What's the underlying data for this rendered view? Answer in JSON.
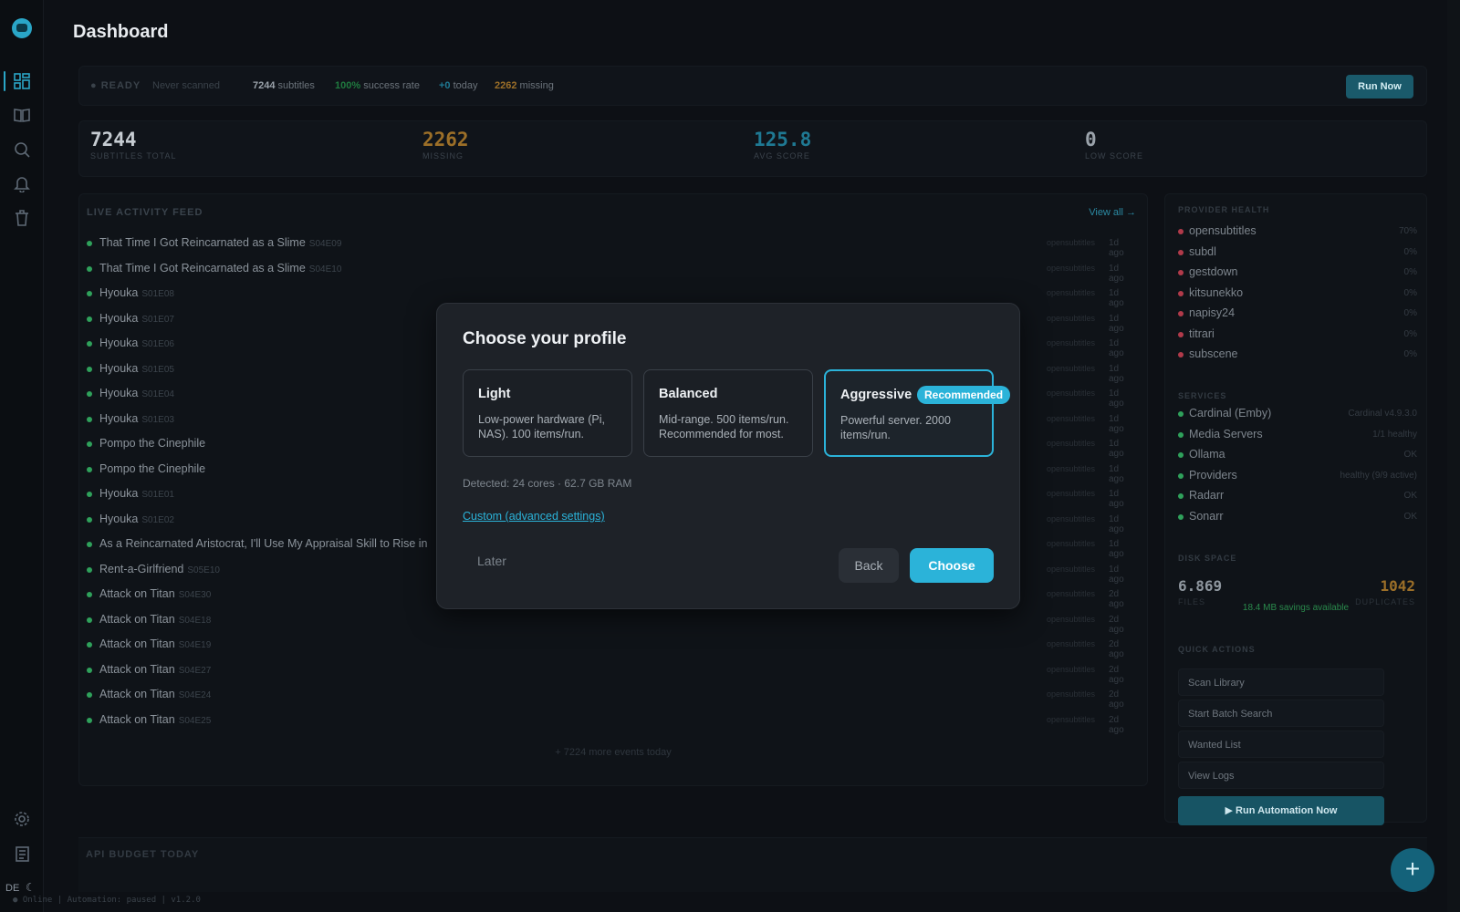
{
  "sidebar": {
    "logo_icon": "subtitle-bubble-icon",
    "nav_icons": [
      "dashboard-icon",
      "library-icon",
      "search-icon",
      "bell-icon",
      "trash-icon"
    ],
    "bottom_icons": [
      "gear-icon",
      "logs-icon"
    ],
    "lang": "DE",
    "theme_icon": "moon-icon"
  },
  "header": {
    "title": "Dashboard"
  },
  "status_bar": {
    "state": "READY",
    "scan_text": "Never scanned",
    "subtitles_count": "7244",
    "subtitles_label": "subtitles",
    "success_rate": "100%",
    "success_label": "success rate",
    "today_count": "+0",
    "today_label": "today",
    "missing_count": "2262",
    "missing_label": "missing",
    "run_now": "Run Now"
  },
  "stats": [
    {
      "value": "7244",
      "label": "SUBTITLES TOTAL",
      "color": "#c6ccd2"
    },
    {
      "value": "2262",
      "label": "MISSING",
      "color": "#9c6f28"
    },
    {
      "value": "125.8",
      "label": "AVG SCORE",
      "color": "#1f7993"
    },
    {
      "value": "0",
      "label": "LOW SCORE",
      "color": "#9aa2aa"
    }
  ],
  "feed": {
    "title": "LIVE ACTIVITY FEED",
    "view_all": "View all →",
    "rows": [
      {
        "title": "That Time I Got Reincarnated as a Slime",
        "ep": "S04E09",
        "provider": "opensubtitles",
        "time": "1d ago"
      },
      {
        "title": "That Time I Got Reincarnated as a Slime",
        "ep": "S04E10",
        "provider": "opensubtitles",
        "time": "1d ago"
      },
      {
        "title": "Hyouka",
        "ep": "S01E08",
        "provider": "opensubtitles",
        "time": "1d ago"
      },
      {
        "title": "Hyouka",
        "ep": "S01E07",
        "provider": "opensubtitles",
        "time": "1d ago"
      },
      {
        "title": "Hyouka",
        "ep": "S01E06",
        "provider": "opensubtitles",
        "time": "1d ago"
      },
      {
        "title": "Hyouka",
        "ep": "S01E05",
        "provider": "opensubtitles",
        "time": "1d ago"
      },
      {
        "title": "Hyouka",
        "ep": "S01E04",
        "provider": "opensubtitles",
        "time": "1d ago"
      },
      {
        "title": "Hyouka",
        "ep": "S01E03",
        "provider": "opensubtitles",
        "time": "1d ago"
      },
      {
        "title": "Pompo the Cinephile",
        "ep": "",
        "provider": "opensubtitles",
        "time": "1d ago"
      },
      {
        "title": "Pompo the Cinephile",
        "ep": "",
        "provider": "opensubtitles",
        "time": "1d ago"
      },
      {
        "title": "Hyouka",
        "ep": "S01E01",
        "provider": "opensubtitles",
        "time": "1d ago"
      },
      {
        "title": "Hyouka",
        "ep": "S01E02",
        "provider": "opensubtitles",
        "time": "1d ago"
      },
      {
        "title": "As a Reincarnated Aristocrat, I'll Use My Appraisal Skill to Rise in",
        "ep": "",
        "provider": "opensubtitles",
        "time": "1d ago"
      },
      {
        "title": "Rent-a-Girlfriend",
        "ep": "S05E10",
        "provider": "opensubtitles",
        "time": "1d ago"
      },
      {
        "title": "Attack on Titan",
        "ep": "S04E30",
        "provider": "opensubtitles",
        "time": "2d ago"
      },
      {
        "title": "Attack on Titan",
        "ep": "S04E18",
        "provider": "opensubtitles",
        "time": "2d ago"
      },
      {
        "title": "Attack on Titan",
        "ep": "S04E19",
        "provider": "opensubtitles",
        "time": "2d ago"
      },
      {
        "title": "Attack on Titan",
        "ep": "S04E27",
        "provider": "opensubtitles",
        "time": "2d ago"
      },
      {
        "title": "Attack on Titan",
        "ep": "S04E24",
        "provider": "opensubtitles",
        "time": "2d ago"
      },
      {
        "title": "Attack on Titan",
        "ep": "S04E25",
        "provider": "opensubtitles",
        "time": "2d ago"
      }
    ],
    "more": "+ 7224 more events today"
  },
  "provider_health": {
    "title": "PROVIDER HEALTH",
    "items": [
      {
        "name": "opensubtitles",
        "value": "70%",
        "color": "#b13a4a"
      },
      {
        "name": "subdl",
        "value": "0%",
        "color": "#b13a4a"
      },
      {
        "name": "gestdown",
        "value": "0%",
        "color": "#b13a4a"
      },
      {
        "name": "kitsunekko",
        "value": "0%",
        "color": "#b13a4a"
      },
      {
        "name": "napisy24",
        "value": "0%",
        "color": "#b13a4a"
      },
      {
        "name": "titrari",
        "value": "0%",
        "color": "#b13a4a"
      },
      {
        "name": "subscene",
        "value": "0%",
        "color": "#b13a4a"
      }
    ]
  },
  "services": {
    "title": "SERVICES",
    "items": [
      {
        "name": "Cardinal (Emby)",
        "value": "Cardinal v4.9.3.0",
        "color": "#2fa15b"
      },
      {
        "name": "Media Servers",
        "value": "1/1 healthy",
        "color": "#2fa15b"
      },
      {
        "name": "Ollama",
        "value": "OK",
        "color": "#2fa15b"
      },
      {
        "name": "Providers",
        "value": "healthy (9/9 active)",
        "color": "#2fa15b"
      },
      {
        "name": "Radarr",
        "value": "OK",
        "color": "#2fa15b"
      },
      {
        "name": "Sonarr",
        "value": "OK",
        "color": "#2fa15b"
      }
    ]
  },
  "disk": {
    "title": "DISK SPACE",
    "files_value": "6.869",
    "files_label": "FILES",
    "dupes_value": "1042",
    "dupes_label": "DUPLICATES",
    "savings": "18.4 MB savings available"
  },
  "quick_actions": {
    "title": "QUICK ACTIONS",
    "items": [
      "Scan Library",
      "Start Batch Search",
      "Wanted List",
      "View Logs"
    ],
    "run_automation": "▶ Run Automation Now"
  },
  "budget": {
    "title": "API BUDGET TODAY"
  },
  "footer": {
    "text": "● Online  |  Automation: paused  |  v1.2.0"
  },
  "fab": {
    "label": "+"
  },
  "modal": {
    "title": "Choose your profile",
    "cards": [
      {
        "title": "Light",
        "desc": "Low-power hardware (Pi, NAS). 100 items/run.",
        "selected": false
      },
      {
        "title": "Balanced",
        "desc": "Mid-range. 500 items/run. Recommended for most.",
        "selected": false
      },
      {
        "title": "Aggressive",
        "desc": "Powerful server. 2000 items/run.",
        "selected": true,
        "badge": "Recommended"
      }
    ],
    "detected": "Detected: 24 cores · 62.7 GB RAM",
    "custom_link": "Custom (advanced settings)",
    "later": "Later",
    "back": "Back",
    "choose": "Choose"
  }
}
